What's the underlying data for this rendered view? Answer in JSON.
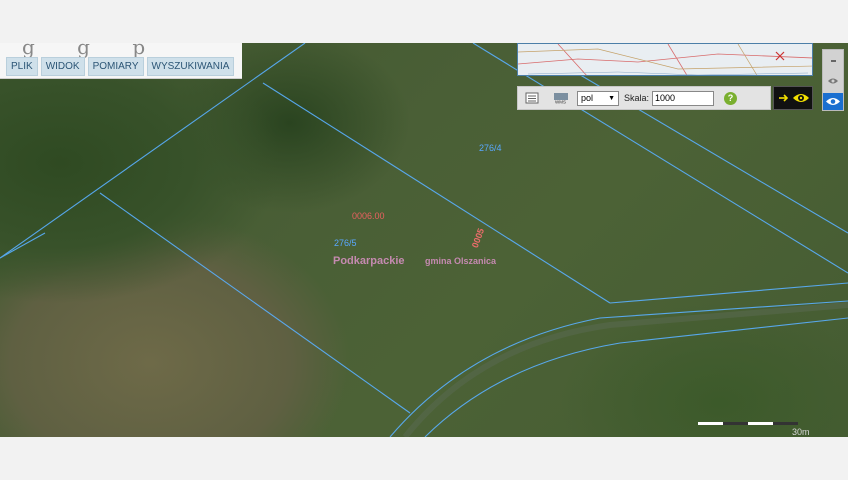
{
  "menu": {
    "items": [
      {
        "label": "PLIK",
        "name": "menu-plik"
      },
      {
        "label": "WIDOK",
        "name": "menu-widok"
      },
      {
        "label": "POMIARY",
        "name": "menu-pomiary"
      },
      {
        "label": "WYSZUKIWANIA",
        "name": "menu-wyszukiwania"
      }
    ]
  },
  "toolbar": {
    "language_value": "pol",
    "scale_label": "Skala:",
    "scale_value": "1000",
    "help_label": "?"
  },
  "map": {
    "parcel_labels": [
      "276/4",
      "276/5"
    ],
    "voivodeship_label": "Podkarpackie",
    "gmina_label": "gmina Olszanica",
    "precinct_label": "0006.00",
    "rotated_label": "0005",
    "scalebar_label": "30m"
  },
  "colors": {
    "parcel_line": "#5ab0ff",
    "menu_bg": "#cfe0ea",
    "menu_text": "#2b5575",
    "label_pink": "#c58ab0",
    "eye_yellow": "#f3e000"
  },
  "icons": [
    "list-icon",
    "wms-icon",
    "chevron-down-icon",
    "help-icon",
    "arrow-right-icon",
    "eye-icon"
  ]
}
